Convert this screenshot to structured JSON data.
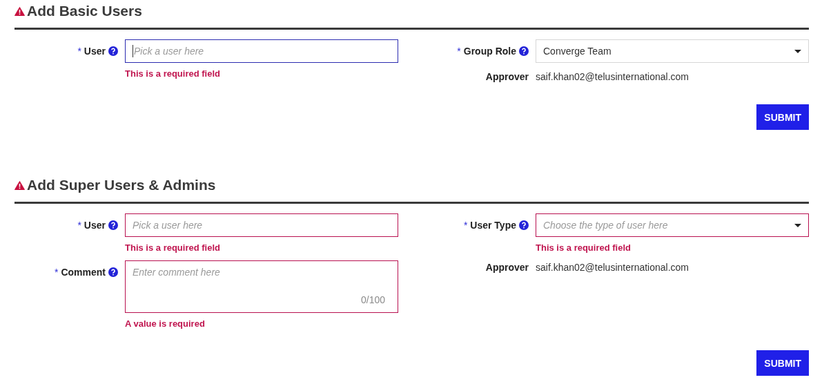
{
  "sections": [
    {
      "title": "Add Basic Users",
      "warning": true,
      "left": [
        {
          "kind": "text",
          "label": "User",
          "required_mark": "*",
          "help": true,
          "placeholder": "Pick a user here",
          "focused": true,
          "invalid": false,
          "error": "This is a required field"
        }
      ],
      "right": [
        {
          "kind": "select",
          "label": "Group Role",
          "required_mark": "*",
          "help": true,
          "value": "Converge Team",
          "focused": false,
          "invalid": false
        },
        {
          "kind": "info",
          "label": "Approver",
          "value": "saif.khan02@telusinternational.com"
        }
      ],
      "submit": "SUBMIT"
    },
    {
      "title": "Add Super Users & Admins",
      "warning": true,
      "left": [
        {
          "kind": "text",
          "label": "User",
          "required_mark": "*",
          "help": true,
          "placeholder": "Pick a user here",
          "focused": false,
          "invalid": true,
          "error": "This is a required field"
        },
        {
          "kind": "textarea",
          "label": "Comment",
          "required_mark": "*",
          "help": true,
          "placeholder": "Enter comment here",
          "counter": "0/100",
          "focused": false,
          "invalid": true,
          "error": "A value is required"
        }
      ],
      "right": [
        {
          "kind": "select",
          "label": "User Type",
          "required_mark": "*",
          "help": true,
          "placeholder": "Choose the type of user here",
          "focused": false,
          "invalid": true,
          "error": "This is a required field"
        },
        {
          "kind": "info",
          "label": "Approver",
          "value": "saif.khan02@telusinternational.com"
        }
      ],
      "submit": "SUBMIT"
    }
  ]
}
